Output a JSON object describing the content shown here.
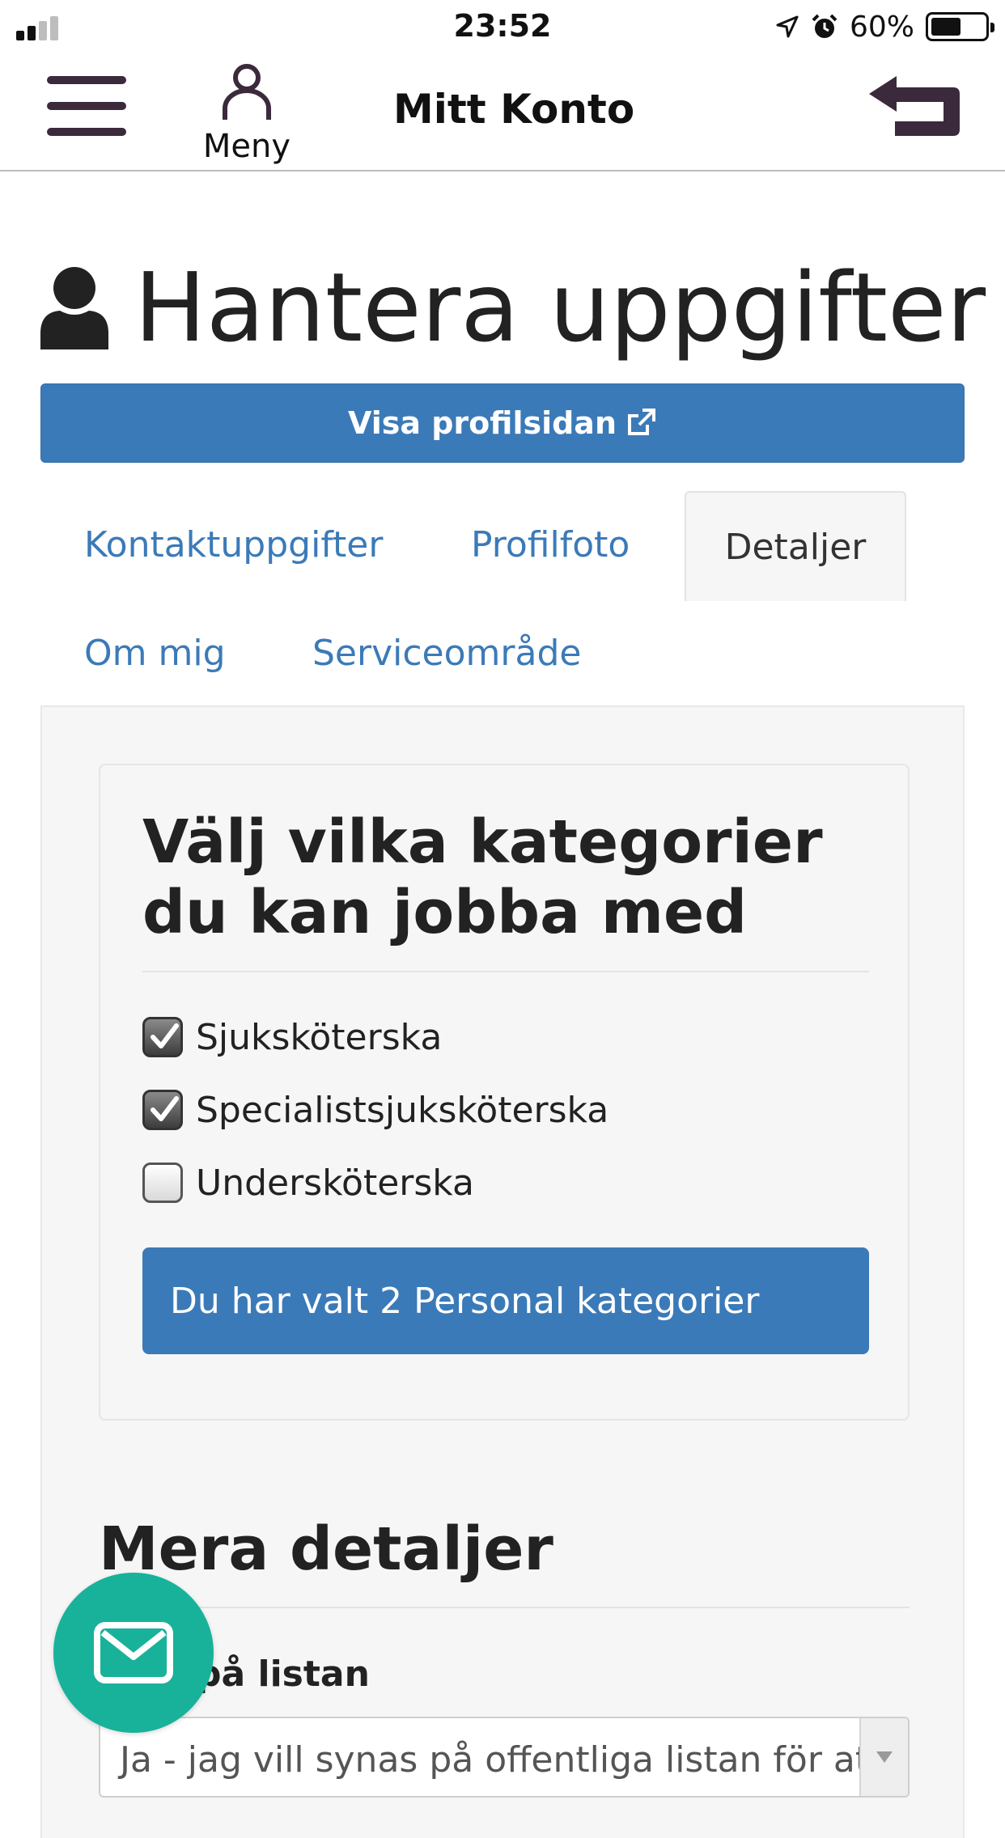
{
  "status_bar": {
    "time": "23:52",
    "battery": "60%"
  },
  "header": {
    "title": "Mitt Konto",
    "menu_label": "Meny"
  },
  "page": {
    "title": "Hantera uppgifter",
    "profile_button": "Visa profilsidan"
  },
  "tabs": [
    {
      "label": "Kontaktuppgifter",
      "active": false
    },
    {
      "label": "Profilfoto",
      "active": false
    },
    {
      "label": "Detaljer",
      "active": true
    },
    {
      "label": "Om mig",
      "active": false
    },
    {
      "label": "Serviceområde",
      "active": false
    }
  ],
  "categories": {
    "title": "Välj vilka kategorier du kan jobba med",
    "items": [
      {
        "label": "Sjuksköterska",
        "checked": true
      },
      {
        "label": "Specialistsjuksköterska",
        "checked": true
      },
      {
        "label": "Undersköterska",
        "checked": false
      }
    ],
    "selected_message": "Du har valt 2 Personal kategorier"
  },
  "details": {
    "title": "Mera detaljer",
    "field_label": "på listan",
    "select_value": "Ja - jag vill synas på offentliga listan för at"
  },
  "colors": {
    "accent": "#3b7ab8",
    "fab": "#18b29a",
    "icon_dark": "#3b2a3b"
  }
}
